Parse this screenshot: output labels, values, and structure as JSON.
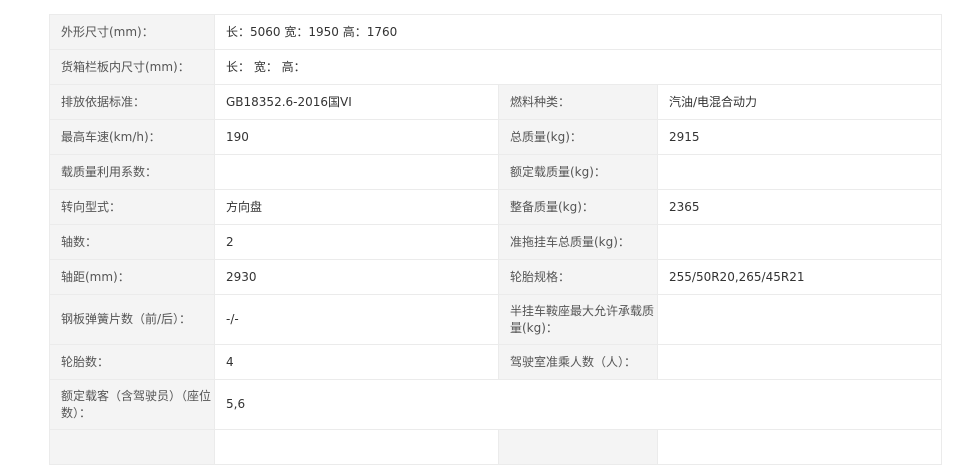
{
  "rows": [
    {
      "label": "外形尺寸(mm)：",
      "value": "长：5060 宽：1950 高：1760"
    },
    {
      "label": "货箱栏板内尺寸(mm)：",
      "value": "长： 宽： 高："
    },
    {
      "label": "排放依据标准：",
      "value": "GB18352.6-2016国VI",
      "label2": "燃料种类：",
      "value2": "汽油/电混合动力"
    },
    {
      "label": "最高车速(km/h)：",
      "value": "190",
      "label2": "总质量(kg)：",
      "value2": "2915"
    },
    {
      "label": "载质量利用系数：",
      "value": "",
      "label2": "额定载质量(kg)：",
      "value2": ""
    },
    {
      "label": "转向型式：",
      "value": "方向盘",
      "label2": "整备质量(kg)：",
      "value2": "2365"
    },
    {
      "label": "轴数：",
      "value": "2",
      "label2": "准拖挂车总质量(kg)：",
      "value2": ""
    },
    {
      "label": "轴距(mm)：",
      "value": "2930",
      "label2": "轮胎规格：",
      "value2": "255/50R20,265/45R21"
    },
    {
      "label": "钢板弹簧片数（前/后）：",
      "value": "-/-",
      "label2": "半挂车鞍座最大允许承载质量(kg)：",
      "value2": ""
    },
    {
      "label": "轮胎数：",
      "value": "4",
      "label2": "驾驶室准乘人数（人）：",
      "value2": ""
    },
    {
      "label": "额定载客（含驾驶员）（座位数）：",
      "value": "5,6"
    },
    {
      "label": "",
      "value": "",
      "label2": "",
      "value2": ""
    }
  ]
}
